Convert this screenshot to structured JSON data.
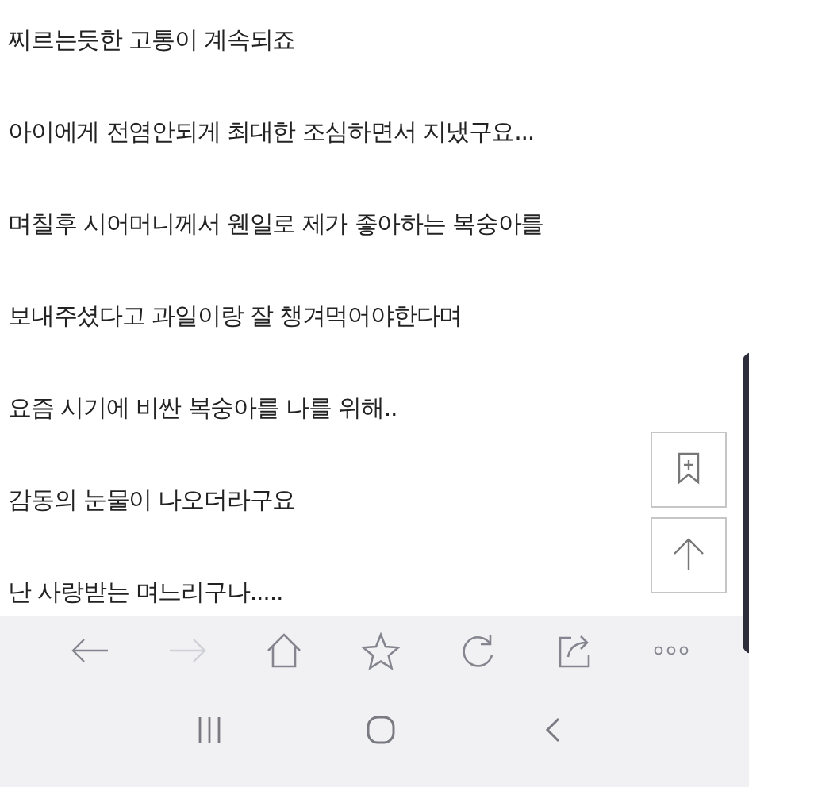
{
  "paragraphs": [
    "찌르는듯한 고통이 계속되죠",
    "아이에게 전염안되게 최대한 조심하면서 지냈구요...",
    "며칠후 시어머니께서 웬일로 제가 좋아하는 복숭아를",
    "보내주셨다고 과일이랑 잘 챙겨먹어야한다며",
    "요즘 시기에 비싼 복숭아를 나를 위해..",
    "감동의 눈물이 나오더라구요",
    "난 사랑받는 며느리구나....."
  ],
  "floating_buttons": [
    {
      "kind": "bookmark-add"
    },
    {
      "kind": "scroll-top"
    }
  ],
  "toolbar": [
    {
      "kind": "back",
      "disabled": false
    },
    {
      "kind": "forward",
      "disabled": true
    },
    {
      "kind": "home",
      "disabled": false
    },
    {
      "kind": "star",
      "disabled": false
    },
    {
      "kind": "reload",
      "disabled": false
    },
    {
      "kind": "share",
      "disabled": false
    },
    {
      "kind": "more",
      "disabled": false
    }
  ],
  "nav_bar": [
    {
      "kind": "recents"
    },
    {
      "kind": "home"
    },
    {
      "kind": "back"
    }
  ]
}
